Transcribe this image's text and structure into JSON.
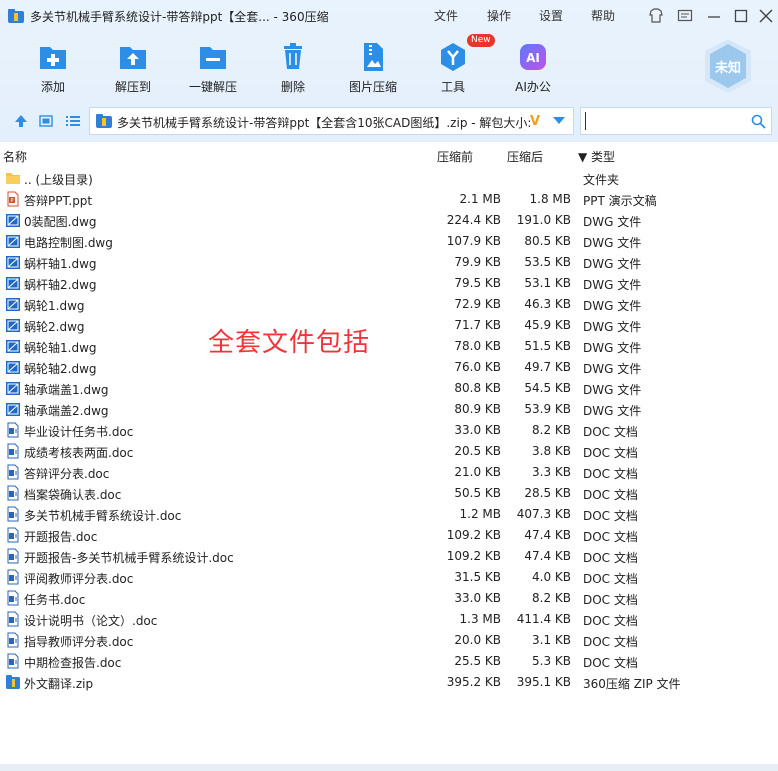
{
  "window": {
    "title": "多关节机械手臂系统设计-带答辩ppt【全套... - 360压缩",
    "menus": [
      "文件",
      "操作",
      "设置",
      "帮助"
    ]
  },
  "toolbar": {
    "buttons": [
      {
        "label": "添加",
        "icon": "add-file-icon"
      },
      {
        "label": "解压到",
        "icon": "extract-to-icon"
      },
      {
        "label": "一键解压",
        "icon": "one-click-extract-icon"
      },
      {
        "label": "删除",
        "icon": "trash-icon"
      },
      {
        "label": "图片压缩",
        "icon": "image-compress-icon"
      },
      {
        "label": "工具",
        "icon": "tools-icon",
        "badge": "New"
      },
      {
        "label": "AI办公",
        "icon": "ai-office-icon"
      }
    ],
    "badge_text": "未知"
  },
  "address": {
    "path": "多关节机械手臂系统设计-带答辩ppt【全套含10张CAD图纸】.zip - 解包大小:",
    "search_placeholder": ""
  },
  "columns": {
    "name": "名称",
    "packed": "压缩前",
    "unpacked": "压缩后",
    "type": "▼ 类型"
  },
  "files": [
    {
      "name": ".. (上级目录)",
      "packed": "",
      "unpacked": "",
      "type": "文件夹",
      "icon": "folder"
    },
    {
      "name": "答辩PPT.ppt",
      "packed": "2.1 MB",
      "unpacked": "1.8 MB",
      "type": "PPT 演示文稿",
      "icon": "ppt"
    },
    {
      "name": "0装配图.dwg",
      "packed": "224.4 KB",
      "unpacked": "191.0 KB",
      "type": "DWG 文件",
      "icon": "dwg"
    },
    {
      "name": "电路控制图.dwg",
      "packed": "107.9 KB",
      "unpacked": "80.5 KB",
      "type": "DWG 文件",
      "icon": "dwg"
    },
    {
      "name": "蜗杆轴1.dwg",
      "packed": "79.9 KB",
      "unpacked": "53.5 KB",
      "type": "DWG 文件",
      "icon": "dwg"
    },
    {
      "name": "蜗杆轴2.dwg",
      "packed": "79.5 KB",
      "unpacked": "53.1 KB",
      "type": "DWG 文件",
      "icon": "dwg"
    },
    {
      "name": "蜗轮1.dwg",
      "packed": "72.9 KB",
      "unpacked": "46.3 KB",
      "type": "DWG 文件",
      "icon": "dwg"
    },
    {
      "name": "蜗轮2.dwg",
      "packed": "71.7 KB",
      "unpacked": "45.9 KB",
      "type": "DWG 文件",
      "icon": "dwg"
    },
    {
      "name": "蜗轮轴1.dwg",
      "packed": "78.0 KB",
      "unpacked": "51.5 KB",
      "type": "DWG 文件",
      "icon": "dwg"
    },
    {
      "name": "蜗轮轴2.dwg",
      "packed": "76.0 KB",
      "unpacked": "49.7 KB",
      "type": "DWG 文件",
      "icon": "dwg"
    },
    {
      "name": "轴承端盖1.dwg",
      "packed": "80.8 KB",
      "unpacked": "54.5 KB",
      "type": "DWG 文件",
      "icon": "dwg"
    },
    {
      "name": "轴承端盖2.dwg",
      "packed": "80.9 KB",
      "unpacked": "53.9 KB",
      "type": "DWG 文件",
      "icon": "dwg"
    },
    {
      "name": "毕业设计任务书.doc",
      "packed": "33.0 KB",
      "unpacked": "8.2 KB",
      "type": "DOC 文档",
      "icon": "doc"
    },
    {
      "name": "成绩考核表两面.doc",
      "packed": "20.5 KB",
      "unpacked": "3.8 KB",
      "type": "DOC 文档",
      "icon": "doc"
    },
    {
      "name": "答辩评分表.doc",
      "packed": "21.0 KB",
      "unpacked": "3.3 KB",
      "type": "DOC 文档",
      "icon": "doc"
    },
    {
      "name": "档案袋确认表.doc",
      "packed": "50.5 KB",
      "unpacked": "28.5 KB",
      "type": "DOC 文档",
      "icon": "doc"
    },
    {
      "name": "多关节机械手臂系统设计.doc",
      "packed": "1.2 MB",
      "unpacked": "407.3 KB",
      "type": "DOC 文档",
      "icon": "doc"
    },
    {
      "name": "开题报告.doc",
      "packed": "109.2 KB",
      "unpacked": "47.4 KB",
      "type": "DOC 文档",
      "icon": "doc"
    },
    {
      "name": "开题报告-多关节机械手臂系统设计.doc",
      "packed": "109.2 KB",
      "unpacked": "47.4 KB",
      "type": "DOC 文档",
      "icon": "doc"
    },
    {
      "name": "评阅教师评分表.doc",
      "packed": "31.5 KB",
      "unpacked": "4.0 KB",
      "type": "DOC 文档",
      "icon": "doc"
    },
    {
      "name": "任务书.doc",
      "packed": "33.0 KB",
      "unpacked": "8.2 KB",
      "type": "DOC 文档",
      "icon": "doc"
    },
    {
      "name": "设计说明书（论文）.doc",
      "packed": "1.3 MB",
      "unpacked": "411.4 KB",
      "type": "DOC 文档",
      "icon": "doc"
    },
    {
      "name": "指导教师评分表.doc",
      "packed": "20.0 KB",
      "unpacked": "3.1 KB",
      "type": "DOC 文档",
      "icon": "doc"
    },
    {
      "name": "中期检查报告.doc",
      "packed": "25.5 KB",
      "unpacked": "5.3 KB",
      "type": "DOC 文档",
      "icon": "doc"
    },
    {
      "name": "外文翻译.zip",
      "packed": "395.2 KB",
      "unpacked": "395.1 KB",
      "type": "360压缩 ZIP 文件",
      "icon": "zip"
    }
  ],
  "overlay_text": "全套文件包括",
  "colors": {
    "accent": "#2d8ee6",
    "overlay": "#f2343a",
    "badge": "#e8352a"
  }
}
